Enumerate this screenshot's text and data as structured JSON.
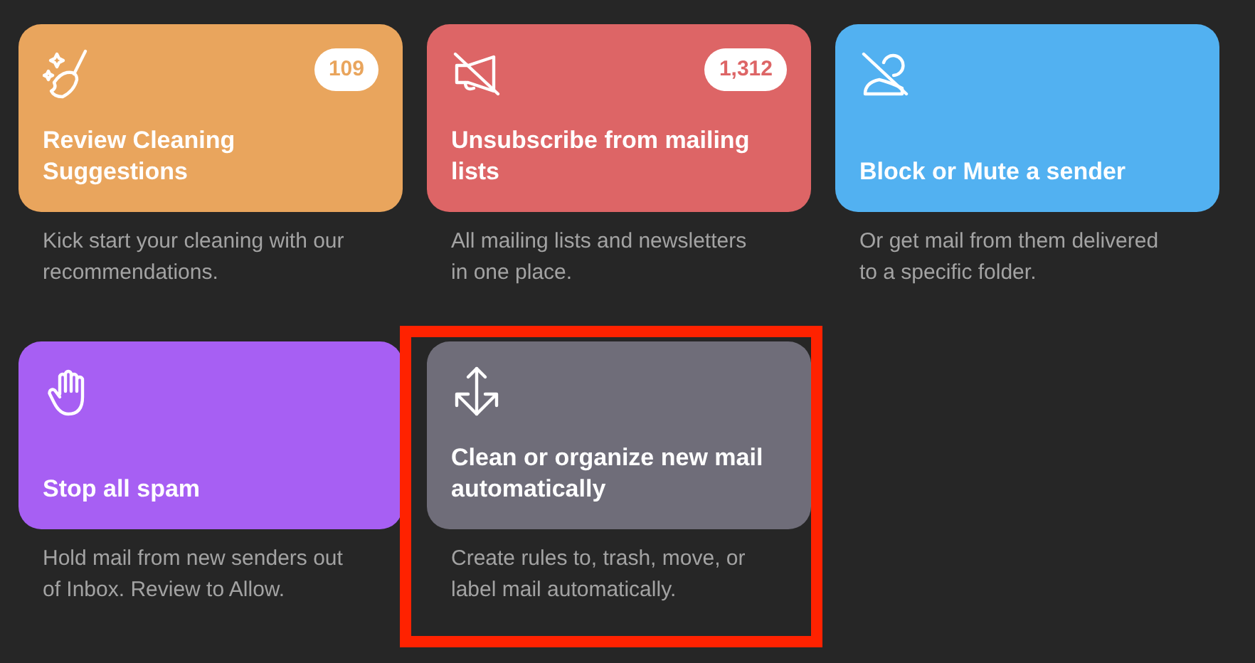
{
  "cards": [
    {
      "kind": "broom",
      "title": "Review Cleaning Suggestions",
      "badge": "109",
      "color": "#e9a55d",
      "description": "Kick start your cleaning with our recommendations.",
      "highlighted": false
    },
    {
      "kind": "megaphone-off",
      "title": "Unsubscribe from mailing lists",
      "badge": "1,312",
      "color": "#dd6566",
      "description": "All mailing lists and newsletters in one place.",
      "highlighted": false
    },
    {
      "kind": "person-off",
      "title": "Block or Mute a sender",
      "color": "#52b1f1",
      "description": "Or get mail from them delivered to a specific folder.",
      "highlighted": false
    },
    {
      "kind": "hand",
      "title": "Stop all spam",
      "color": "#a75ff3",
      "description": "Hold mail from new senders out of Inbox. Review to Allow.",
      "highlighted": false
    },
    {
      "kind": "arrows",
      "title": "Clean or organize new mail automatically",
      "color": "#6f6d79",
      "description": "Create rules to, trash, move, or label mail automatically.",
      "highlighted": true
    }
  ]
}
